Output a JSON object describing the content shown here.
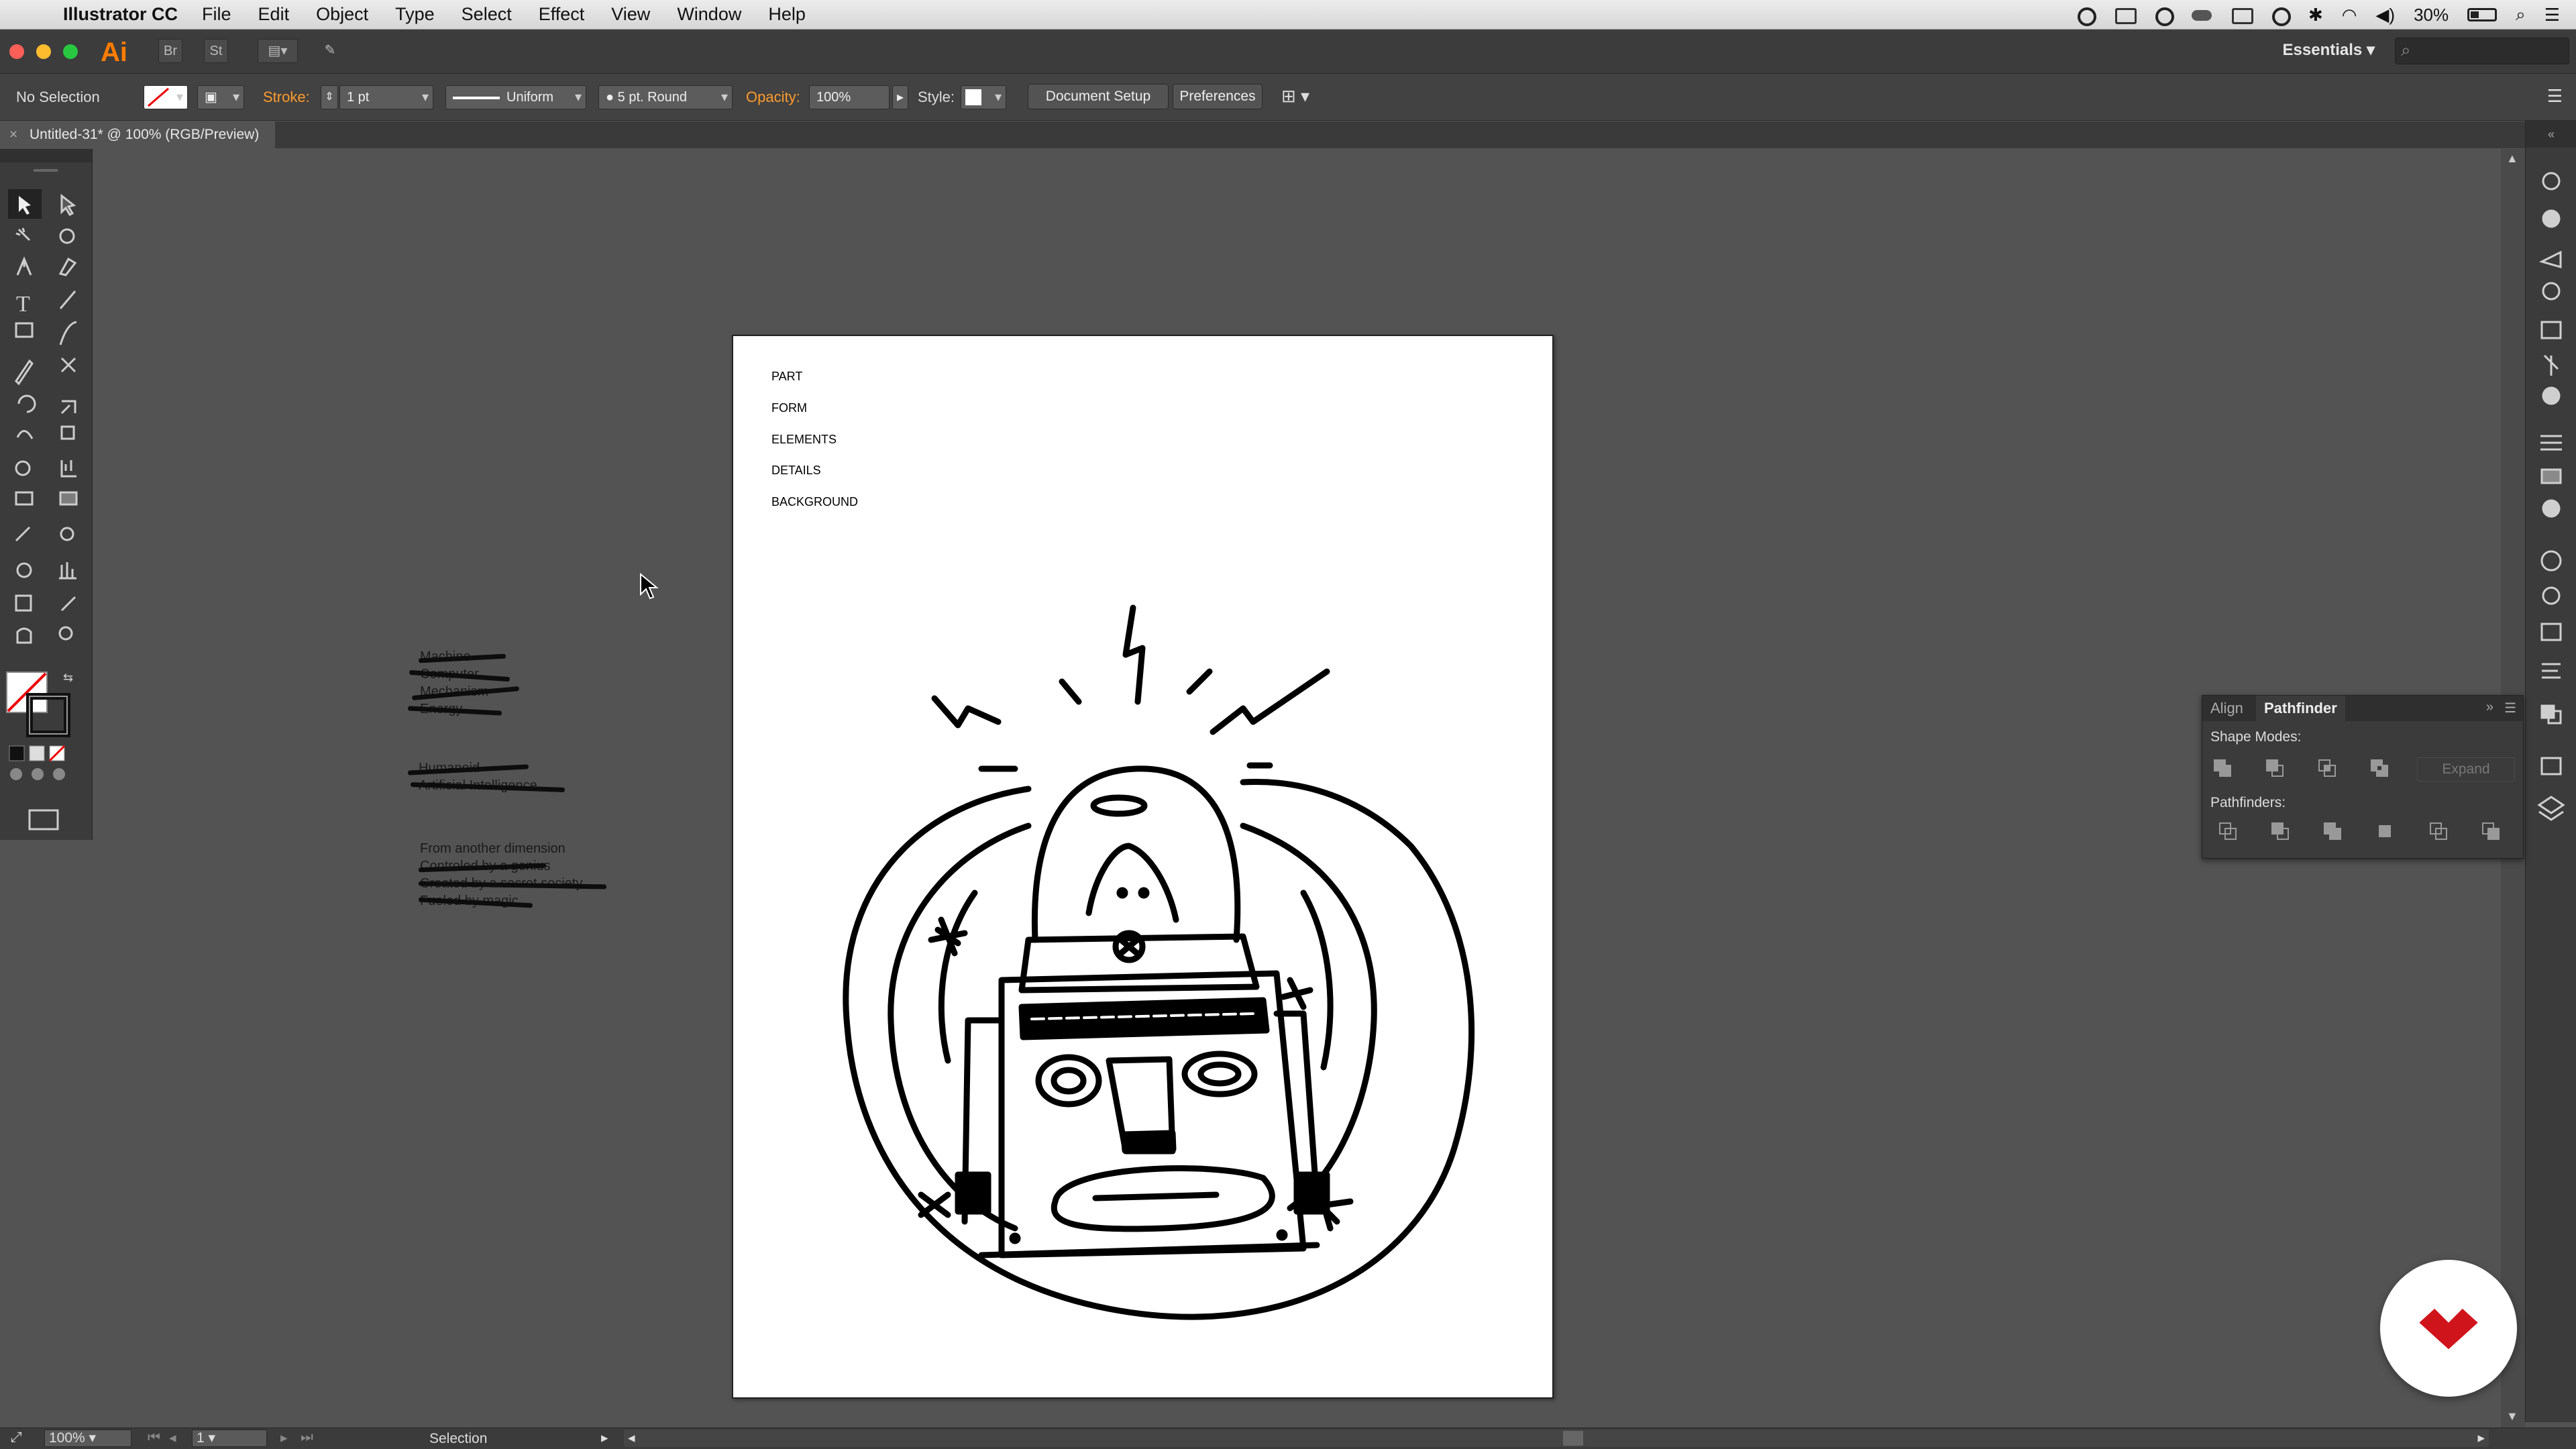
{
  "menubar": {
    "app_name": "Illustrator CC",
    "items": [
      "File",
      "Edit",
      "Object",
      "Type",
      "Select",
      "Effect",
      "View",
      "Window",
      "Help"
    ],
    "battery": "30%"
  },
  "appbar": {
    "logo": "Ai",
    "bridge_label": "Br",
    "stock_label": "St",
    "workspace": "Essentials"
  },
  "control": {
    "selection_status": "No Selection",
    "stroke_label": "Stroke:",
    "stroke_weight": "1 pt",
    "profile": "Uniform",
    "brush": "5 pt. Round",
    "opacity_label": "Opacity:",
    "opacity": "100%",
    "style_label": "Style:",
    "document_setup": "Document Setup",
    "preferences": "Preferences"
  },
  "document": {
    "tab_title": "Untitled-31* @ 100% (RGB/Preview)"
  },
  "artboard": {
    "labels": [
      "PART",
      "FORM",
      "ELEMENTS",
      "DETAILS",
      "BACKGROUND"
    ]
  },
  "scratch": {
    "group1": [
      "Machine",
      "Computer",
      "Mechanism",
      "Energy"
    ],
    "group2": [
      "Humanoid",
      "Artificial Intelligence"
    ],
    "group3": [
      "From another dimension",
      "Controled by a genius",
      "Created by a secret society",
      "Fueled by magic"
    ]
  },
  "pathfinder": {
    "tab_align": "Align",
    "tab_pathfinder": "Pathfinder",
    "shape_modes": "Shape Modes:",
    "expand": "Expand",
    "pathfinders": "Pathfinders:"
  },
  "statusbar": {
    "zoom": "100%",
    "artboard_number": "1",
    "tool": "Selection"
  },
  "colors": {
    "accent_orange": "#ff9b2b",
    "logo_red": "#d0141c",
    "canvas": "#535353"
  }
}
